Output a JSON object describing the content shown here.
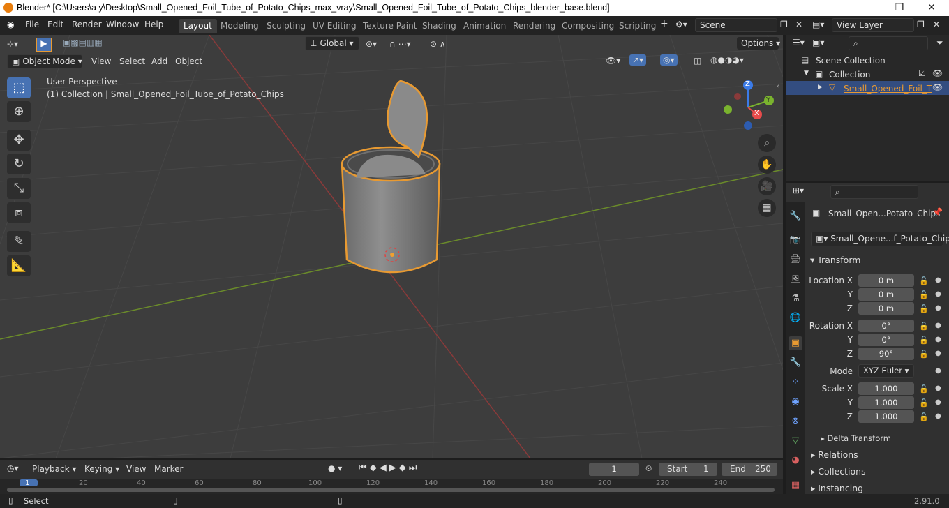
{
  "window": {
    "title": "Blender* [C:\\Users\\a y\\Desktop\\Small_Opened_Foil_Tube_of_Potato_Chips_max_vray\\Small_Opened_Foil_Tube_of_Potato_Chips_blender_base.blend]",
    "minimize": "—",
    "maximize": "❐",
    "close": "✕"
  },
  "menu": [
    "File",
    "Edit",
    "Render",
    "Window",
    "Help"
  ],
  "workspaces": [
    "Layout",
    "Modeling",
    "Sculpting",
    "UV Editing",
    "Texture Paint",
    "Shading",
    "Animation",
    "Rendering",
    "Compositing",
    "Scripting"
  ],
  "scene": "Scene",
  "view_layer": "View Layer",
  "toolbar": {
    "orientation": "Global",
    "options": "Options"
  },
  "viewport": {
    "mode": "Object Mode",
    "menus": [
      "View",
      "Select",
      "Add",
      "Object"
    ],
    "perspective": "User Perspective",
    "collection_info": "(1) Collection | Small_Opened_Foil_Tube_of_Potato_Chips"
  },
  "gizmo": {
    "x": "X",
    "y": "Y",
    "z": "Z"
  },
  "outliner": {
    "scene_collection": "Scene Collection",
    "collection": "Collection",
    "object": "Small_Opened_Foil_T"
  },
  "properties": {
    "object_name": "Small_Open...Potato_Chips",
    "data_name": "Small_Opene...f_Potato_Chips",
    "transform": "Transform",
    "location_x_label": "Location X",
    "y_label": "Y",
    "z_label": "Z",
    "rotation_x_label": "Rotation X",
    "scale_x_label": "Scale X",
    "mode_label": "Mode",
    "location": [
      "0 m",
      "0 m",
      "0 m"
    ],
    "rotation": [
      "0°",
      "0°",
      "90°"
    ],
    "rotation_mode": "XYZ Euler",
    "scale": [
      "1.000",
      "1.000",
      "1.000"
    ],
    "delta": "Delta Transform",
    "relations": "Relations",
    "collections": "Collections",
    "instancing": "Instancing"
  },
  "timeline": {
    "menus": [
      "Playback",
      "Keying",
      "View",
      "Marker"
    ],
    "current_frame": "1",
    "start_label": "Start",
    "start": "1",
    "end_label": "End",
    "end": "250",
    "ruler": [
      "1",
      "20",
      "40",
      "60",
      "80",
      "100",
      "120",
      "140",
      "160",
      "180",
      "200",
      "220",
      "240"
    ]
  },
  "status": {
    "select": "Select",
    "version": "2.91.0"
  }
}
